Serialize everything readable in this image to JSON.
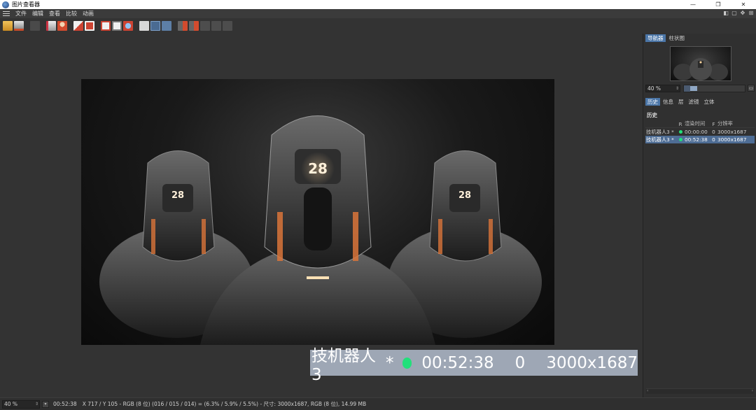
{
  "window": {
    "title": "图片查看器",
    "controls": [
      "—",
      "❐",
      "✕"
    ]
  },
  "menu": {
    "items": [
      "文件",
      "编辑",
      "查看",
      "比较",
      "动画"
    ]
  },
  "navigator": {
    "tabs": [
      "导航器",
      "柱状图"
    ],
    "zoom_value": "40 %",
    "zoom_level": 0.4
  },
  "panel": {
    "tabs": [
      "历史",
      "信息",
      "层",
      "滤镜",
      "立体"
    ],
    "section_title": "历史",
    "columns": [
      "",
      "R",
      "渲染时间",
      "F",
      "分辨率"
    ],
    "rows": [
      {
        "name": "技机器人3 *",
        "time": "00:00:00",
        "f": "0",
        "res": "3000x1687",
        "selected": false
      },
      {
        "name": "技机器人3 *",
        "time": "00:52:38",
        "f": "0",
        "res": "3000x1687",
        "selected": true
      }
    ],
    "status_color": "#22e07a"
  },
  "highlight": {
    "name": "技机器人3",
    "star": "*",
    "time": "00:52:38",
    "f": "0",
    "res": "3000x1687"
  },
  "status": {
    "zoom": "40 %",
    "time": "00:52:38",
    "info": "X 717 / Y 105 - RGB (8 位) (016 / 015 / 014) = (6.3% / 5.9% / 5.5%) - 尺寸: 3000x1687, RGB (8 位), 14.99 MB"
  },
  "icons": {
    "toolbar": [
      "open-icon",
      "save-icon",
      "delete-icon",
      "crop-icon",
      "user-icon",
      "copy-icon",
      "paste-icon",
      "window-icon",
      "window-alt-icon",
      "globe-icon",
      "ab-compare-icon",
      "split-a-icon",
      "split-b-icon",
      "region-a-icon",
      "region-b-icon",
      "grid-icon",
      "swap-icon",
      "reset-icon"
    ],
    "accent": "#4b76a8"
  },
  "render_image": {
    "description_label": "28"
  }
}
